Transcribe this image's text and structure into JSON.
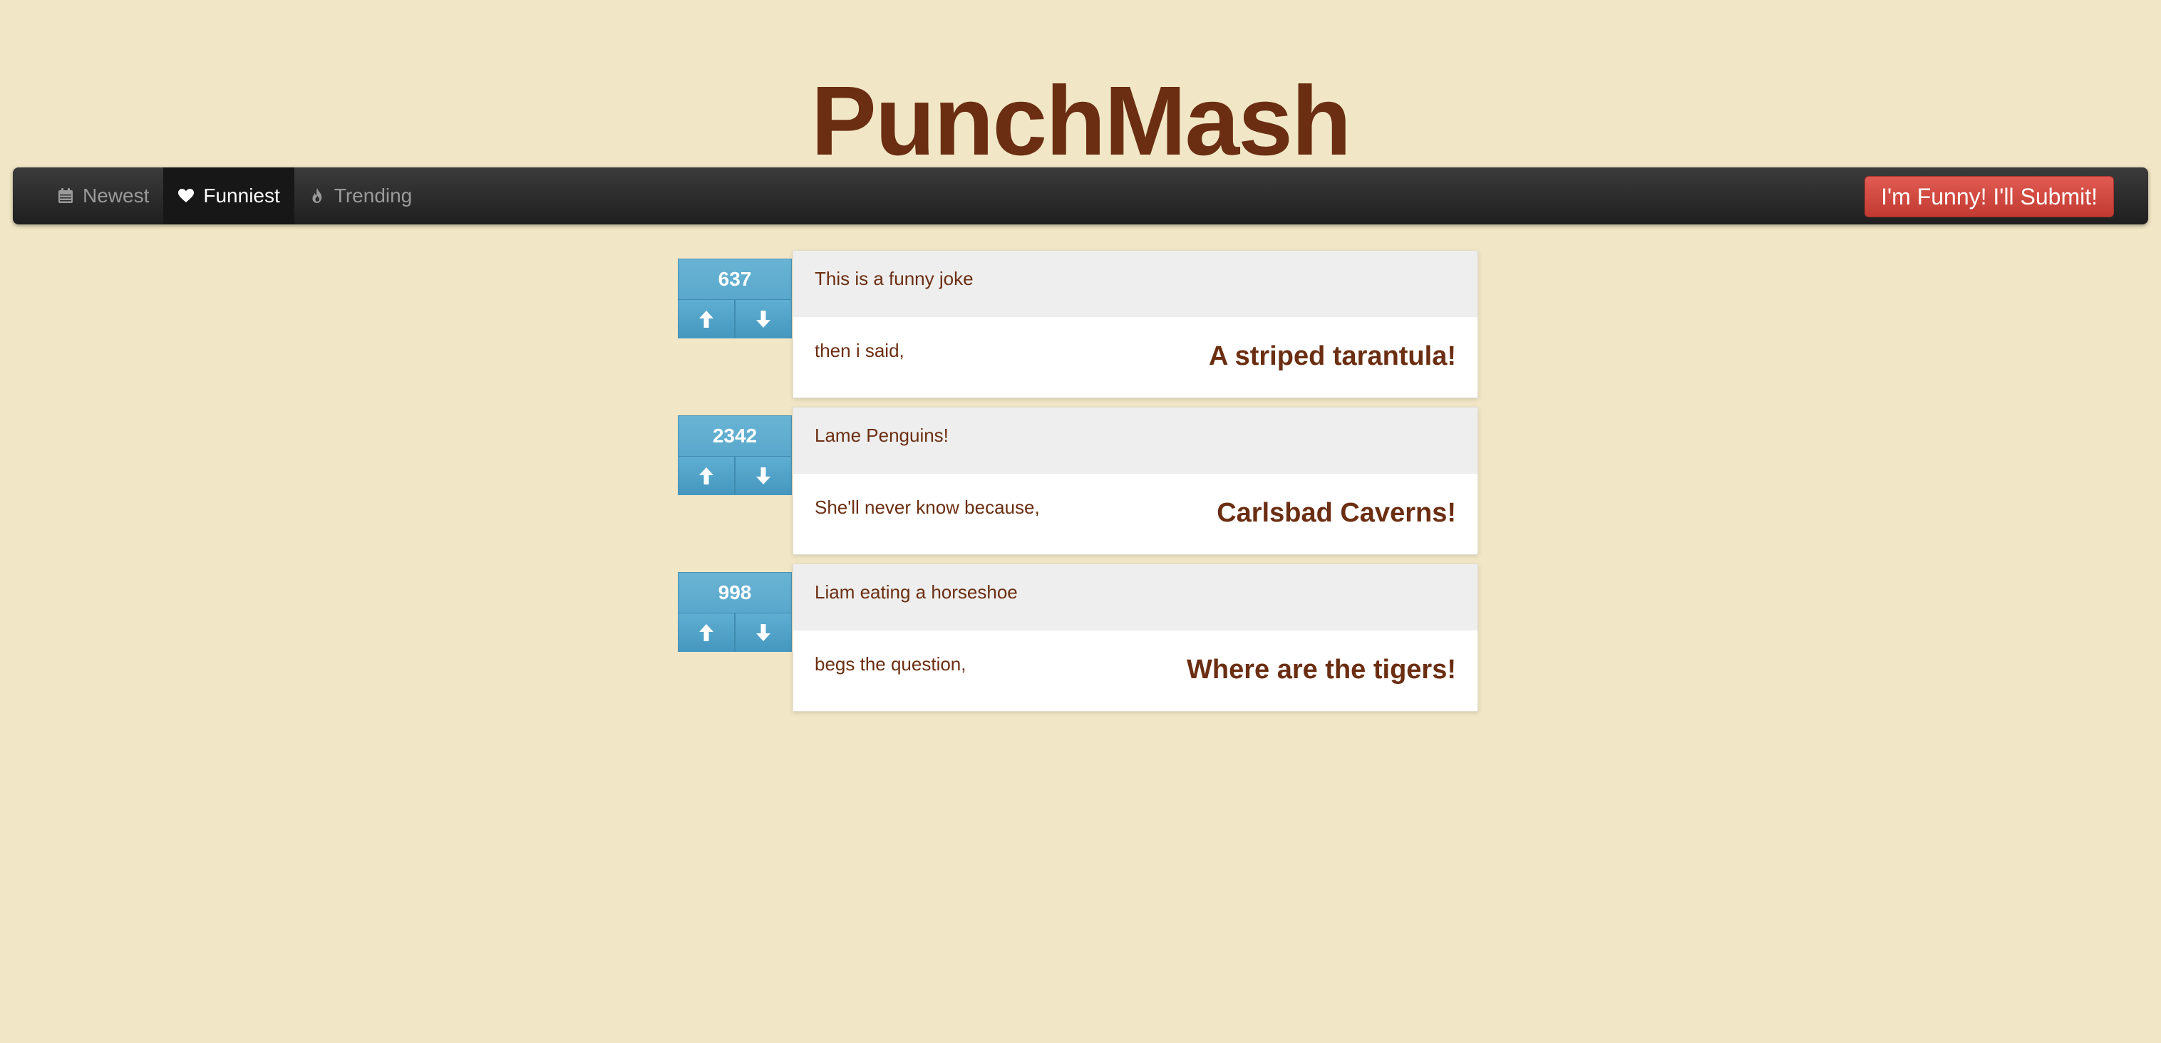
{
  "site": {
    "title": "PunchMash"
  },
  "nav": {
    "items": [
      {
        "label": "Newest",
        "icon": "calendar-icon",
        "active": false
      },
      {
        "label": "Funniest",
        "icon": "heart-icon",
        "active": true
      },
      {
        "label": "Trending",
        "icon": "flame-icon",
        "active": false
      }
    ],
    "submit_label": "I'm Funny! I'll Submit!"
  },
  "colors": {
    "background": "#f1e7c6",
    "title": "#6b2e12",
    "vote_box": "#5ba9ce",
    "submit_button": "#d04a42",
    "navbar": "#2b2b2b"
  },
  "jokes": [
    {
      "score": "637",
      "setup": "This is a funny joke",
      "lead": "then i said,",
      "punchline": "A striped tarantula!"
    },
    {
      "score": "2342",
      "setup": "Lame Penguins!",
      "lead": "She'll never know because,",
      "punchline": "Carlsbad Caverns!"
    },
    {
      "score": "998",
      "setup": "Liam eating a horseshoe",
      "lead": "begs the question,",
      "punchline": "Where are the tigers!"
    }
  ]
}
